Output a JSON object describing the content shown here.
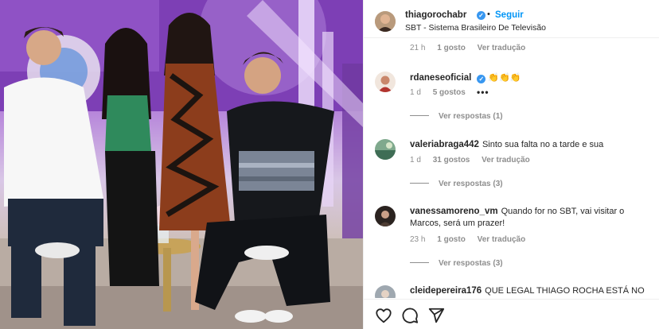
{
  "post": {
    "author": {
      "username": "thiagorochabr",
      "verified": true,
      "follow_label": "Seguir",
      "separator": "•"
    },
    "subtitle": "SBT - Sistema Brasileiro De Televisão"
  },
  "comments": [
    {
      "id": "c0",
      "username": "",
      "text": "",
      "time": "21 h",
      "likes": "1 gosto",
      "reply_label": "Ver tradução",
      "partial": "top"
    },
    {
      "id": "c1",
      "username": "rdaneseoficial",
      "verified": true,
      "text": "👏👏👏",
      "time": "1 d",
      "likes": "5 gostos",
      "more": "•••",
      "replies": "Ver respostas (1)"
    },
    {
      "id": "c2",
      "username": "valeriabraga442",
      "verified": false,
      "text": "Sinto sua falta no a tarde e sua",
      "time": "1 d",
      "likes": "31 gostos",
      "reply_label": "Ver tradução",
      "replies": "Ver respostas (3)"
    },
    {
      "id": "c3",
      "username": "vanessamoreno_vm",
      "verified": false,
      "text": "Quando for no SBT, vai visitar o Marcos, será um prazer!",
      "time": "23 h",
      "likes": "1 gosto",
      "reply_label": "Ver tradução",
      "replies": "Ver respostas (3)"
    },
    {
      "id": "c4",
      "username": "cleidepereira176",
      "verified": false,
      "text": "QUE LEGAL THIAGO ROCHA ESTÁ NO",
      "partial": "bottom"
    }
  ],
  "actions": [
    "heart-icon",
    "comment-icon",
    "share-icon"
  ],
  "colors": {
    "link": "#0095f6",
    "verified": "#3897f0",
    "muted": "#8e8e8e",
    "text": "#262626"
  }
}
